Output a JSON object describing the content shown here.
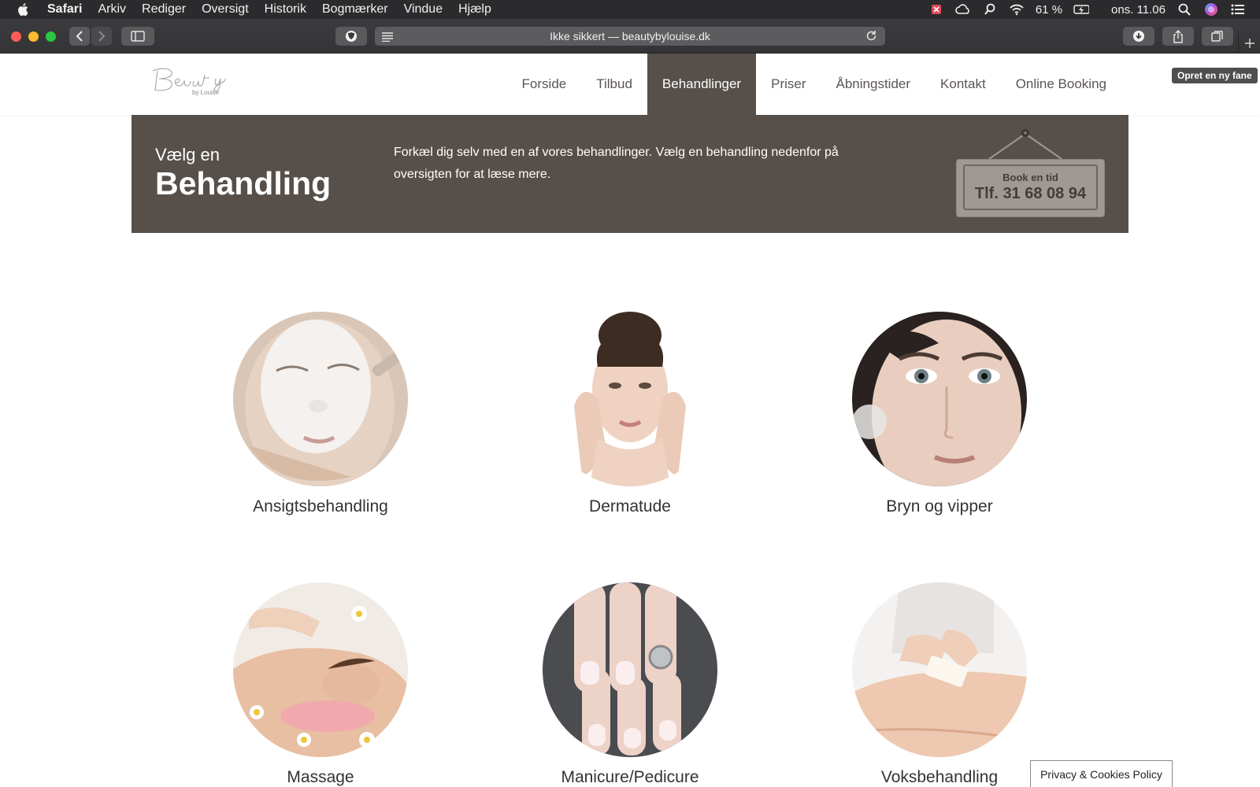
{
  "menubar": {
    "app": "Safari",
    "items": [
      "Arkiv",
      "Rediger",
      "Oversigt",
      "Historik",
      "Bogmærker",
      "Vindue",
      "Hjælp"
    ],
    "battery": "61 %",
    "clock": "ons. 11.06"
  },
  "browser": {
    "address": "Ikke sikkert — beautybylouise.dk",
    "new_tab_tooltip": "Opret en ny fane"
  },
  "site": {
    "logo_text": "Beauty",
    "logo_sub": "by Louise",
    "nav": [
      "Forside",
      "Tilbud",
      "Behandlinger",
      "Priser",
      "Åbningstider",
      "Kontakt",
      "Online Booking"
    ],
    "active_nav": "Behandlinger",
    "hero": {
      "kicker": "Vælg en",
      "title": "Behandling",
      "description": "Forkæl dig selv med en af vores behandlinger. Vælg en behandling nedenfor på oversigten for at læse mere.",
      "sign_line1": "Book en tid",
      "sign_line2": "Tlf. 31 68 08 94"
    },
    "treatments": [
      {
        "label": "Ansigtsbehandling",
        "image": "facial-mask-photo"
      },
      {
        "label": "Dermatude",
        "image": "woman-face-photo"
      },
      {
        "label": "Bryn og vipper",
        "image": "eyes-closeup-photo"
      },
      {
        "label": "Massage",
        "image": "back-massage-photo"
      },
      {
        "label": "Manicure/Pedicure",
        "image": "french-nails-photo"
      },
      {
        "label": "Voksbehandling",
        "image": "leg-wax-photo"
      }
    ],
    "privacy": "Privacy & Cookies Policy"
  }
}
